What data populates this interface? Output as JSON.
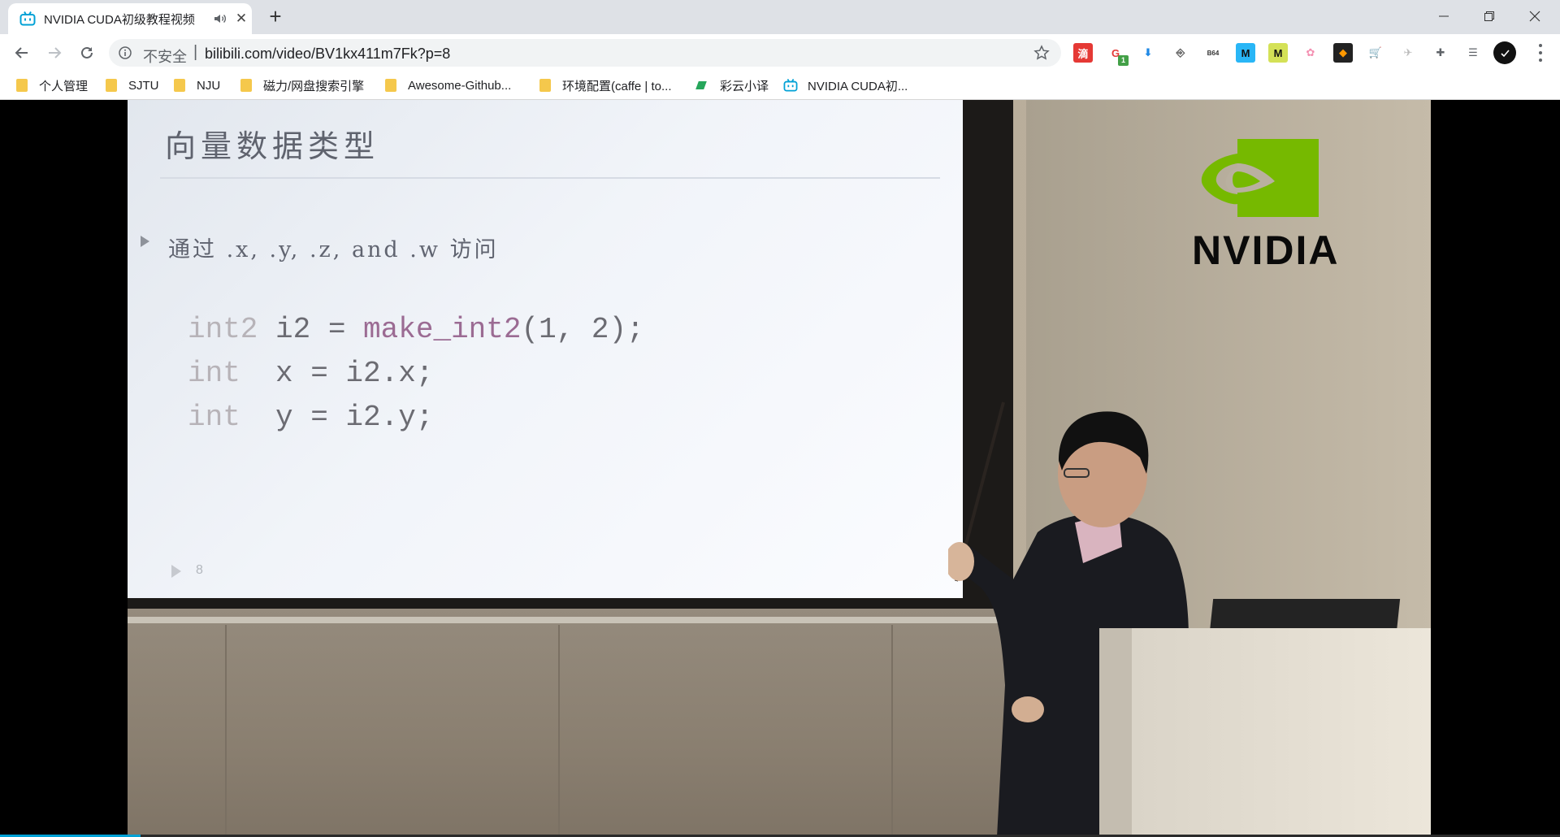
{
  "tab": {
    "title": "NVIDIA CUDA初级教程视频",
    "favicon": "bilibili-tv-icon",
    "audio_icon": "speaker-icon"
  },
  "toolbar": {
    "security_label": "不安全",
    "separator": "|",
    "url": "bilibili.com/video/BV1kx411m7Fk?p=8",
    "extensions": [
      {
        "name": "ext-red-icon",
        "glyph": "滴",
        "color": "#ffffff",
        "bg": "#e53935"
      },
      {
        "name": "ext-badge-icon",
        "glyph": "G",
        "color": "#e53935",
        "bg": "#ffffff",
        "badge": "1"
      },
      {
        "name": "ext-download-icon",
        "glyph": "⬇",
        "color": "#1e88e5",
        "bg": "#ffffff"
      },
      {
        "name": "ext-terminal-icon",
        "glyph": "⎆",
        "color": "#555555",
        "bg": "#ffffff"
      },
      {
        "name": "ext-base64-icon",
        "glyph": "B64",
        "color": "#333333",
        "bg": "#ffffff"
      },
      {
        "name": "ext-m-blue-icon",
        "glyph": "M",
        "color": "#111111",
        "bg": "#29b6f6"
      },
      {
        "name": "ext-m-yellow-icon",
        "glyph": "M",
        "color": "#111111",
        "bg": "#d4e157"
      },
      {
        "name": "ext-pink-icon",
        "glyph": "✿",
        "color": "#f48fb1",
        "bg": "#ffffff"
      },
      {
        "name": "ext-color-picker-icon",
        "glyph": "◆",
        "color": "#ff9800",
        "bg": "#222222"
      },
      {
        "name": "ext-cart-icon",
        "glyph": "🛒",
        "color": "#e53935",
        "bg": "#ffffff"
      },
      {
        "name": "ext-bird-icon",
        "glyph": "✈",
        "color": "#bbbbbb",
        "bg": "#ffffff"
      },
      {
        "name": "puzzle-extensions-icon",
        "glyph": "✚",
        "color": "#5f6368",
        "bg": "#ffffff"
      },
      {
        "name": "reading-list-icon",
        "glyph": "☰",
        "color": "#5f6368",
        "bg": "#ffffff"
      }
    ]
  },
  "bookmarks": [
    {
      "label": "个人管理",
      "icon": "folder-icon"
    },
    {
      "label": "SJTU",
      "icon": "folder-icon"
    },
    {
      "label": "NJU",
      "icon": "folder-icon"
    },
    {
      "label": "磁力/网盘搜索引擎",
      "icon": "folder-icon"
    },
    {
      "label": "Awesome-Github...",
      "icon": "folder-icon"
    },
    {
      "label": "环境配置(caffe | to...",
      "icon": "folder-icon"
    },
    {
      "label": "彩云小译",
      "icon": "caiyun-icon"
    },
    {
      "label": "NVIDIA CUDA初...",
      "icon": "bilibili-tv-icon"
    }
  ],
  "video": {
    "slide": {
      "title": "向量数据类型",
      "bullet": "通过 .x,  .y,  .z,  and  .w 访问",
      "code": [
        {
          "kw": "int2",
          "rest_a": " i2 = ",
          "fn": "make_int2",
          "rest_b": "(1, 2);"
        },
        {
          "kw": "int",
          "rest_a": "  x = i2.x;",
          "fn": "",
          "rest_b": ""
        },
        {
          "kw": "int",
          "rest_a": "  y = i2.y;",
          "fn": "",
          "rest_b": ""
        }
      ],
      "page_number": "8"
    },
    "logo_text": "NVIDIA",
    "progress_fraction": 0.09
  },
  "colors": {
    "nvidia_green": "#76b900",
    "bilibili_blue": "#00a1d6"
  }
}
